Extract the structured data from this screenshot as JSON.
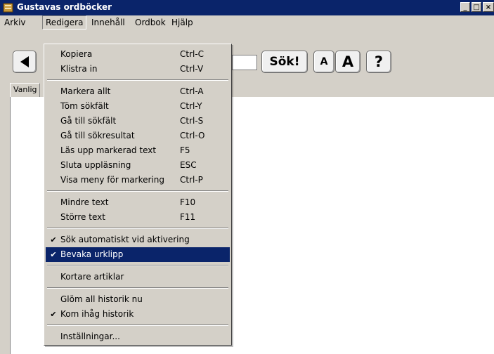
{
  "window": {
    "title": "Gustavas ordböcker"
  },
  "menubar": {
    "items": [
      "Arkiv",
      "Redigera",
      "Innehåll",
      "Ordbok",
      "Hjälp"
    ],
    "active": "Redigera"
  },
  "toolbar": {
    "search_label": "Sök!",
    "font_small_label": "A",
    "font_large_label": "A",
    "help_label": "?"
  },
  "tab": {
    "label": "Vanlig"
  },
  "edit_menu": {
    "groups": [
      [
        {
          "label": "Kopiera",
          "shortcut": "Ctrl-C"
        },
        {
          "label": "Klistra in",
          "shortcut": "Ctrl-V"
        }
      ],
      [
        {
          "label": "Markera allt",
          "shortcut": "Ctrl-A"
        },
        {
          "label": "Töm sökfält",
          "shortcut": "Ctrl-Y"
        },
        {
          "label": "Gå till sökfält",
          "shortcut": "Ctrl-S"
        },
        {
          "label": "Gå till sökresultat",
          "shortcut": "Ctrl-O"
        },
        {
          "label": "Läs upp markerad text",
          "shortcut": "F5"
        },
        {
          "label": "Sluta uppläsning",
          "shortcut": "ESC"
        },
        {
          "label": "Visa meny för markering",
          "shortcut": "Ctrl-P"
        }
      ],
      [
        {
          "label": "Mindre text",
          "shortcut": "F10"
        },
        {
          "label": "Större text",
          "shortcut": "F11"
        }
      ],
      [
        {
          "label": "Sök automatiskt vid aktivering",
          "checked": true
        },
        {
          "label": "Bevaka urklipp",
          "checked": true,
          "highlighted": true
        }
      ],
      [
        {
          "label": "Kortare artiklar"
        }
      ],
      [
        {
          "label": "Glöm all historik nu"
        },
        {
          "label": "Kom ihåg historik",
          "checked": true
        }
      ],
      [
        {
          "label": "Inställningar..."
        }
      ]
    ]
  },
  "colors": {
    "titlebar": "#0a246a",
    "highlight": "#0a246a",
    "face": "#d4d0c8"
  }
}
